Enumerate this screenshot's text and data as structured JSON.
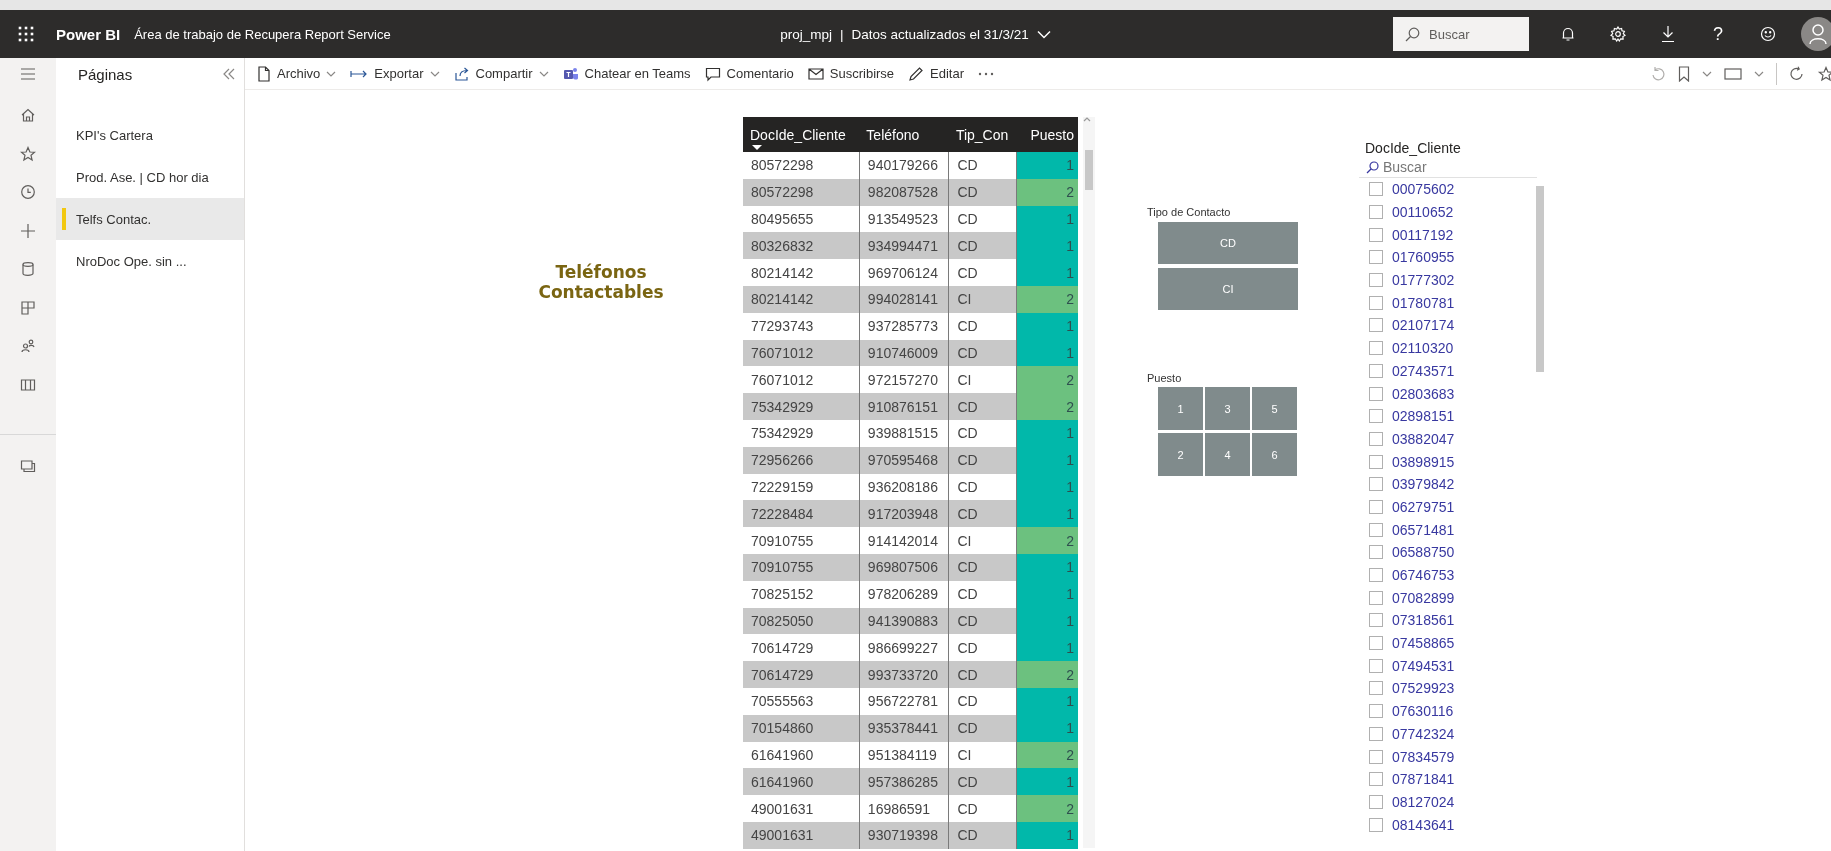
{
  "header": {
    "app_name": "Power BI",
    "workspace": "Área de trabajo de Recupera Report Service",
    "report": "proj_mpj",
    "separator": "|",
    "updated": "Datos actualizados el 31/3/21",
    "search": {
      "placeholder": "Buscar"
    },
    "help": "?"
  },
  "pages_pane": {
    "title": "Páginas",
    "pages": [
      {
        "label": "KPI's Cartera",
        "selected": false
      },
      {
        "label": "Prod. Ase. | CD hor dia",
        "selected": false
      },
      {
        "label": "Telfs Contac.",
        "selected": true
      },
      {
        "label": "NroDoc Ope. sin ...",
        "selected": false
      }
    ]
  },
  "toolbar": {
    "items": [
      {
        "label": "Archivo",
        "dropdown": true
      },
      {
        "label": "Exportar",
        "dropdown": true
      },
      {
        "label": "Compartir",
        "dropdown": true
      },
      {
        "label": "Chatear en Teams",
        "dropdown": false
      },
      {
        "label": "Comentario",
        "dropdown": false
      },
      {
        "label": "Suscribirse",
        "dropdown": false
      },
      {
        "label": "Editar",
        "dropdown": false
      }
    ]
  },
  "report": {
    "title": "Teléfonos Contactables",
    "table": {
      "columns": [
        {
          "label": "DocIde_Cliente",
          "sorted": true
        },
        {
          "label": "Teléfono",
          "sorted": false
        },
        {
          "label": "Tip_Con",
          "sorted": false
        },
        {
          "label": "Puesto",
          "sorted": false
        }
      ],
      "rows": [
        {
          "cells": [
            "80572298",
            "940179266",
            "CD",
            "1"
          ],
          "color": "#01b8aa"
        },
        {
          "cells": [
            "80572298",
            "982087528",
            "CD",
            "2"
          ],
          "color": "#6cc17f"
        },
        {
          "cells": [
            "80495655",
            "913549523",
            "CD",
            "1"
          ],
          "color": "#01b8aa"
        },
        {
          "cells": [
            "80326832",
            "934994471",
            "CD",
            "1"
          ],
          "color": "#01b8aa"
        },
        {
          "cells": [
            "80214142",
            "969706124",
            "CD",
            "1"
          ],
          "color": "#01b8aa"
        },
        {
          "cells": [
            "80214142",
            "994028141",
            "CI",
            "2"
          ],
          "color": "#6cc17f"
        },
        {
          "cells": [
            "77293743",
            "937285773",
            "CD",
            "1"
          ],
          "color": "#01b8aa"
        },
        {
          "cells": [
            "76071012",
            "910746009",
            "CD",
            "1"
          ],
          "color": "#01b8aa"
        },
        {
          "cells": [
            "76071012",
            "972157270",
            "CI",
            "2"
          ],
          "color": "#6cc17f"
        },
        {
          "cells": [
            "75342929",
            "910876151",
            "CD",
            "2"
          ],
          "color": "#6cc17f"
        },
        {
          "cells": [
            "75342929",
            "939881515",
            "CD",
            "1"
          ],
          "color": "#01b8aa"
        },
        {
          "cells": [
            "72956266",
            "970595468",
            "CD",
            "1"
          ],
          "color": "#01b8aa"
        },
        {
          "cells": [
            "72229159",
            "936208186",
            "CD",
            "1"
          ],
          "color": "#01b8aa"
        },
        {
          "cells": [
            "72228484",
            "917203948",
            "CD",
            "1"
          ],
          "color": "#01b8aa"
        },
        {
          "cells": [
            "70910755",
            "914142014",
            "CI",
            "2"
          ],
          "color": "#6cc17f"
        },
        {
          "cells": [
            "70910755",
            "969807506",
            "CD",
            "1"
          ],
          "color": "#01b8aa"
        },
        {
          "cells": [
            "70825152",
            "978206289",
            "CD",
            "1"
          ],
          "color": "#01b8aa"
        },
        {
          "cells": [
            "70825050",
            "941390883",
            "CD",
            "1"
          ],
          "color": "#01b8aa"
        },
        {
          "cells": [
            "70614729",
            "986699227",
            "CD",
            "1"
          ],
          "color": "#01b8aa"
        },
        {
          "cells": [
            "70614729",
            "993733720",
            "CD",
            "2"
          ],
          "color": "#6cc17f"
        },
        {
          "cells": [
            "70555563",
            "956722781",
            "CD",
            "1"
          ],
          "color": "#01b8aa"
        },
        {
          "cells": [
            "70154860",
            "935378441",
            "CD",
            "1"
          ],
          "color": "#01b8aa"
        },
        {
          "cells": [
            "61641960",
            "951384119",
            "CI",
            "2"
          ],
          "color": "#6cc17f"
        },
        {
          "cells": [
            "61641960",
            "957386285",
            "CD",
            "1"
          ],
          "color": "#01b8aa"
        },
        {
          "cells": [
            "49001631",
            "16986591",
            "CD",
            "2"
          ],
          "color": "#6cc17f"
        },
        {
          "cells": [
            "49001631",
            "930719398",
            "CD",
            "1"
          ],
          "color": "#01b8aa"
        }
      ]
    },
    "tipo_slicer": {
      "title": "Tipo de Contacto",
      "options": [
        {
          "label": "CD",
          "selected": false
        },
        {
          "label": "CI",
          "selected": false
        }
      ]
    },
    "puesto_slicer": {
      "title": "Puesto",
      "options": [
        {
          "label": "1",
          "selected": false
        },
        {
          "label": "3",
          "selected": false
        },
        {
          "label": "5",
          "selected": false
        },
        {
          "label": "2",
          "selected": false
        },
        {
          "label": "4",
          "selected": false
        },
        {
          "label": "6",
          "selected": false
        }
      ]
    },
    "list_slicer": {
      "title": "DocIde_Cliente",
      "search": {
        "placeholder": "Buscar"
      },
      "items": [
        {
          "label": "00075602",
          "checked": false
        },
        {
          "label": "00110652",
          "checked": false
        },
        {
          "label": "00117192",
          "checked": false
        },
        {
          "label": "01760955",
          "checked": false
        },
        {
          "label": "01777302",
          "checked": false
        },
        {
          "label": "01780781",
          "checked": false
        },
        {
          "label": "02107174",
          "checked": false
        },
        {
          "label": "02110320",
          "checked": false
        },
        {
          "label": "02743571",
          "checked": false
        },
        {
          "label": "02803683",
          "checked": false
        },
        {
          "label": "02898151",
          "checked": false
        },
        {
          "label": "03882047",
          "checked": false
        },
        {
          "label": "03898915",
          "checked": false
        },
        {
          "label": "03979842",
          "checked": false
        },
        {
          "label": "06279751",
          "checked": false
        },
        {
          "label": "06571481",
          "checked": false
        },
        {
          "label": "06588750",
          "checked": false
        },
        {
          "label": "06746753",
          "checked": false
        },
        {
          "label": "07082899",
          "checked": false
        },
        {
          "label": "07318561",
          "checked": false
        },
        {
          "label": "07458865",
          "checked": false
        },
        {
          "label": "07494531",
          "checked": false
        },
        {
          "label": "07529923",
          "checked": false
        },
        {
          "label": "07630116",
          "checked": false
        },
        {
          "label": "07742324",
          "checked": false
        },
        {
          "label": "07834579",
          "checked": false
        },
        {
          "label": "07871841",
          "checked": false
        },
        {
          "label": "08127024",
          "checked": false
        },
        {
          "label": "08143641",
          "checked": false
        }
      ]
    }
  }
}
